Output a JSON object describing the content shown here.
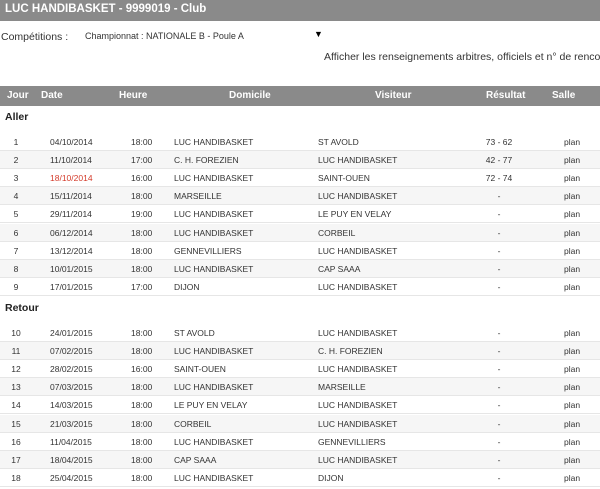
{
  "title": "LUC HANDIBASKET - 9999019 - Club",
  "competitions_label": "Compétitions :",
  "competition_selected": "Championnat : NATIONALE B - Poule A",
  "info_link": "Afficher les renseignements arbitres, officiels et n° de rencontre",
  "columns": [
    "Jour",
    "Date",
    "Heure",
    "Domicile",
    "Visiteur",
    "Résultat",
    "Salle"
  ],
  "colors": {
    "header_bg": "#8a8a8a",
    "highlight_date": "#d43b2b"
  },
  "sections": [
    {
      "title": "Aller",
      "rows": [
        {
          "jour": "1",
          "date": "04/10/2014",
          "heure": "18:00",
          "domicile": "LUC HANDIBASKET",
          "visiteur": "ST AVOLD",
          "resultat": "73 - 62",
          "salle": "plan"
        },
        {
          "jour": "2",
          "date": "11/10/2014",
          "heure": "17:00",
          "domicile": "C. H. FOREZIEN",
          "visiteur": "LUC HANDIBASKET",
          "resultat": "42 - 77",
          "salle": "plan"
        },
        {
          "jour": "3",
          "date": "18/10/2014",
          "heure": "16:00",
          "domicile": "LUC HANDIBASKET",
          "visiteur": "SAINT-OUEN",
          "resultat": "72 - 74",
          "salle": "plan",
          "highlight": true
        },
        {
          "jour": "4",
          "date": "15/11/2014",
          "heure": "18:00",
          "domicile": "MARSEILLE",
          "visiteur": "LUC HANDIBASKET",
          "resultat": "-",
          "salle": "plan"
        },
        {
          "jour": "5",
          "date": "29/11/2014",
          "heure": "19:00",
          "domicile": "LUC HANDIBASKET",
          "visiteur": "LE PUY EN VELAY",
          "resultat": "-",
          "salle": "plan"
        },
        {
          "jour": "6",
          "date": "06/12/2014",
          "heure": "18:00",
          "domicile": "LUC HANDIBASKET",
          "visiteur": "CORBEIL",
          "resultat": "-",
          "salle": "plan"
        },
        {
          "jour": "7",
          "date": "13/12/2014",
          "heure": "18:00",
          "domicile": "GENNEVILLIERS",
          "visiteur": "LUC HANDIBASKET",
          "resultat": "-",
          "salle": "plan"
        },
        {
          "jour": "8",
          "date": "10/01/2015",
          "heure": "18:00",
          "domicile": "LUC HANDIBASKET",
          "visiteur": "CAP SAAA",
          "resultat": "-",
          "salle": "plan"
        },
        {
          "jour": "9",
          "date": "17/01/2015",
          "heure": "17:00",
          "domicile": "DIJON",
          "visiteur": "LUC HANDIBASKET",
          "resultat": "-",
          "salle": "plan"
        }
      ]
    },
    {
      "title": "Retour",
      "rows": [
        {
          "jour": "10",
          "date": "24/01/2015",
          "heure": "18:00",
          "domicile": "ST AVOLD",
          "visiteur": "LUC HANDIBASKET",
          "resultat": "-",
          "salle": "plan"
        },
        {
          "jour": "11",
          "date": "07/02/2015",
          "heure": "18:00",
          "domicile": "LUC HANDIBASKET",
          "visiteur": "C. H. FOREZIEN",
          "resultat": "-",
          "salle": "plan"
        },
        {
          "jour": "12",
          "date": "28/02/2015",
          "heure": "16:00",
          "domicile": "SAINT-OUEN",
          "visiteur": "LUC HANDIBASKET",
          "resultat": "-",
          "salle": "plan"
        },
        {
          "jour": "13",
          "date": "07/03/2015",
          "heure": "18:00",
          "domicile": "LUC HANDIBASKET",
          "visiteur": "MARSEILLE",
          "resultat": "-",
          "salle": "plan"
        },
        {
          "jour": "14",
          "date": "14/03/2015",
          "heure": "18:00",
          "domicile": "LE PUY EN VELAY",
          "visiteur": "LUC HANDIBASKET",
          "resultat": "-",
          "salle": "plan"
        },
        {
          "jour": "15",
          "date": "21/03/2015",
          "heure": "18:00",
          "domicile": "CORBEIL",
          "visiteur": "LUC HANDIBASKET",
          "resultat": "-",
          "salle": "plan"
        },
        {
          "jour": "16",
          "date": "11/04/2015",
          "heure": "18:00",
          "domicile": "LUC HANDIBASKET",
          "visiteur": "GENNEVILLIERS",
          "resultat": "-",
          "salle": "plan"
        },
        {
          "jour": "17",
          "date": "18/04/2015",
          "heure": "18:00",
          "domicile": "CAP SAAA",
          "visiteur": "LUC HANDIBASKET",
          "resultat": "-",
          "salle": "plan"
        },
        {
          "jour": "18",
          "date": "25/04/2015",
          "heure": "18:00",
          "domicile": "LUC HANDIBASKET",
          "visiteur": "DIJON",
          "resultat": "-",
          "salle": "plan"
        }
      ]
    }
  ]
}
